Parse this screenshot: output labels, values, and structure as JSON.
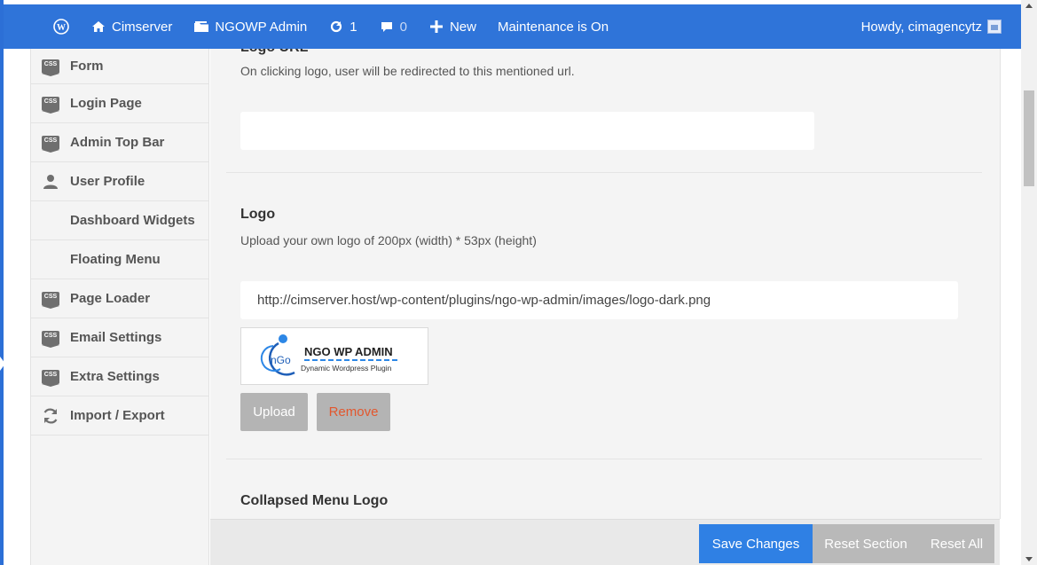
{
  "adminbar": {
    "site_name": "Cimserver",
    "admin_name": "NGOWP Admin",
    "updates_count": "1",
    "comments_count": "0",
    "new_label": "New",
    "maintenance_label": "Maintenance is On",
    "howdy": "Howdy, cimagencytz"
  },
  "sidebar": {
    "items": [
      {
        "label": "Form",
        "icon": "css-icon"
      },
      {
        "label": "Login Page",
        "icon": "css-icon"
      },
      {
        "label": "Admin Top Bar",
        "icon": "css-icon"
      },
      {
        "label": "User Profile",
        "icon": "user-icon"
      },
      {
        "label": "Dashboard Widgets",
        "icon": ""
      },
      {
        "label": "Floating Menu",
        "icon": ""
      },
      {
        "label": "Page Loader",
        "icon": "css-icon"
      },
      {
        "label": "Email Settings",
        "icon": "css-icon"
      },
      {
        "label": "Extra Settings",
        "icon": "css-icon"
      },
      {
        "label": "Import / Export",
        "icon": "refresh-icon"
      }
    ],
    "css_badge": "CSS"
  },
  "main": {
    "logo_url_title_cut": "Logo URL",
    "logo_url_desc": "On clicking logo, user will be redirected to this mentioned url.",
    "logo_url_value": "",
    "logo_title": "Logo",
    "logo_desc": "Upload your own logo of 200px (width) * 53px (height)",
    "logo_value": "http://cimserver.host/wp-content/plugins/ngo-wp-admin/images/logo-dark.png",
    "logo_preview": {
      "brand": "NGO WP ADMIN",
      "tagline": "Dynamic Wordpress Plugin",
      "mark": "nGo"
    },
    "upload_label": "Upload",
    "remove_label": "Remove",
    "collapsed_title": "Collapsed Menu Logo"
  },
  "footer": {
    "save_label": "Save Changes",
    "reset_section_label": "Reset Section",
    "reset_all_label": "Reset All"
  },
  "colors": {
    "adminbar": "#2f74d9",
    "save": "#2f80e4",
    "remove_text": "#e2572e"
  }
}
